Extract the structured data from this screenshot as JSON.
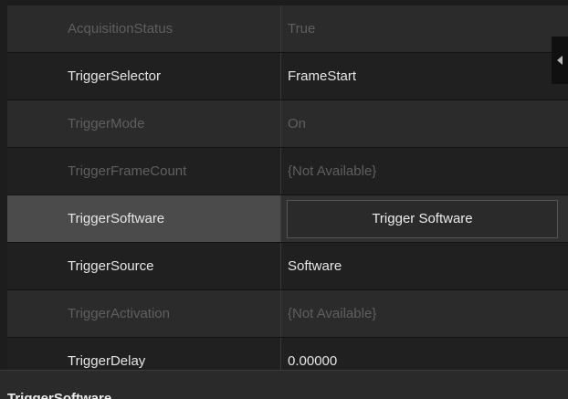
{
  "properties": [
    {
      "name": "AcquisitionStatus",
      "value": "True"
    },
    {
      "name": "TriggerSelector",
      "value": "FrameStart"
    },
    {
      "name": "TriggerMode",
      "value": "On"
    },
    {
      "name": "TriggerFrameCount",
      "value": "{Not Available}"
    },
    {
      "name": "TriggerSoftware",
      "button_label": "Trigger Software"
    },
    {
      "name": "TriggerSource",
      "value": "Software"
    },
    {
      "name": "TriggerActivation",
      "value": "{Not Available}"
    },
    {
      "name": "TriggerDelay",
      "value": "0.00000"
    }
  ],
  "description": {
    "title": "TriggerSoftware"
  },
  "icons": {
    "collapse_tab": "chevron-left-icon"
  },
  "colors": {
    "background": "#1d1d1d",
    "row_dark": "#202020",
    "row_light": "#2b2b2b",
    "selected_name": "#4b4b4b",
    "text": "#e6e6e6",
    "disabled_text": "#5f5f5f"
  }
}
